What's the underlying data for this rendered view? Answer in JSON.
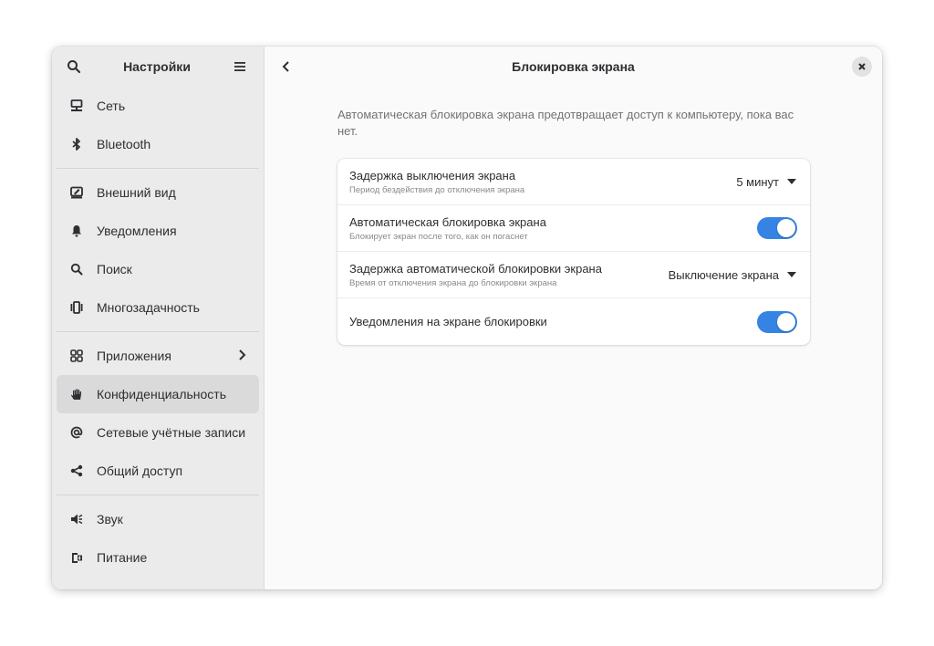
{
  "sidebar": {
    "title": "Настройки",
    "items": [
      {
        "label": "Сеть",
        "icon": "network-icon"
      },
      {
        "label": "Bluetooth",
        "icon": "bluetooth-icon"
      },
      {
        "label": "Внешний вид",
        "icon": "appearance-icon"
      },
      {
        "label": "Уведомления",
        "icon": "bell-icon"
      },
      {
        "label": "Поиск",
        "icon": "search-icon"
      },
      {
        "label": "Многозадачность",
        "icon": "multitasking-icon"
      },
      {
        "label": "Приложения",
        "icon": "apps-icon"
      },
      {
        "label": "Конфиденциальность",
        "icon": "hand-icon"
      },
      {
        "label": "Сетевые учётные записи",
        "icon": "at-icon"
      },
      {
        "label": "Общий доступ",
        "icon": "share-icon"
      },
      {
        "label": "Звук",
        "icon": "speaker-icon"
      },
      {
        "label": "Питание",
        "icon": "power-icon"
      }
    ],
    "selected": "Конфиденциальность"
  },
  "page": {
    "title": "Блокировка экрана",
    "description": "Автоматическая блокировка экрана предотвращает доступ к компьютеру, пока вас нет."
  },
  "settings": [
    {
      "title": "Задержка выключения экрана",
      "subtitle": "Период бездействия до отключения экрана",
      "value": "5 минут"
    },
    {
      "title": "Автоматическая блокировка экрана",
      "subtitle": "Блокирует экран после того, как он погаснет",
      "enabled": true
    },
    {
      "title": "Задержка автоматической блокировки экрана",
      "subtitle": "Время от отключения экрана до блокировки экрана",
      "value": "Выключение экрана"
    },
    {
      "title": "Уведомления на экране блокировки",
      "enabled": true
    }
  ],
  "colors": {
    "accent": "#3584e4",
    "sidebar_bg": "#ebebeb",
    "selected_bg": "#dadada"
  }
}
